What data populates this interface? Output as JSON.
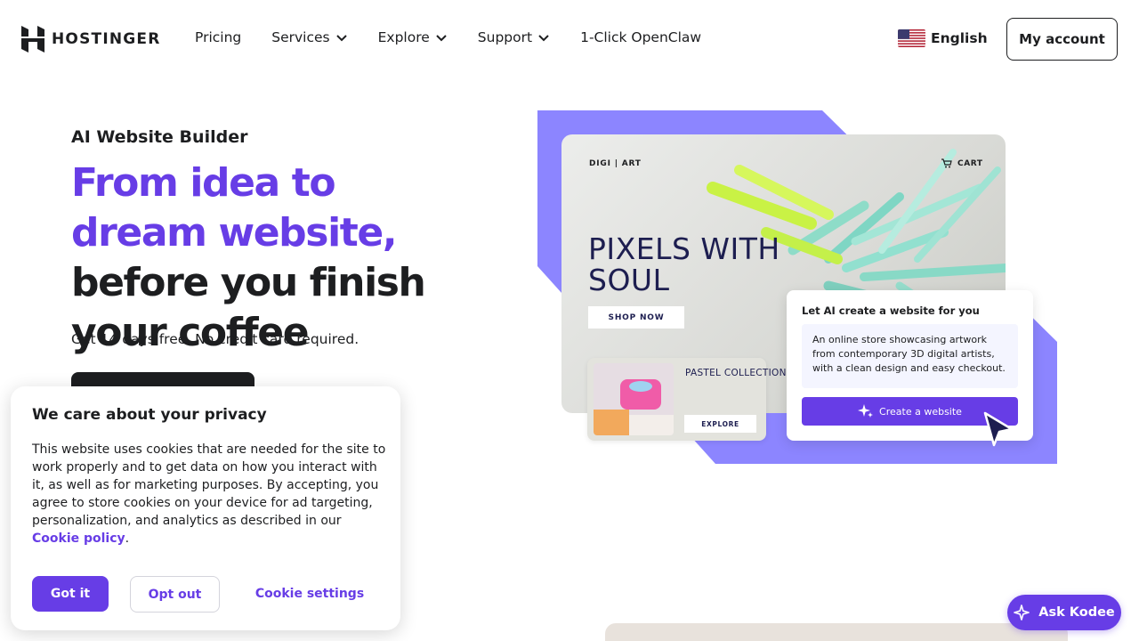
{
  "header": {
    "brand": "HOSTINGER",
    "nav": [
      {
        "label": "Pricing",
        "has_dropdown": false
      },
      {
        "label": "Services",
        "has_dropdown": true
      },
      {
        "label": "Explore",
        "has_dropdown": true
      },
      {
        "label": "Support",
        "has_dropdown": true
      },
      {
        "label": "1-Click OpenClaw",
        "has_dropdown": false
      }
    ],
    "language": "English",
    "language_icon": "us-flag-icon",
    "account_label": "My account"
  },
  "hero": {
    "eyebrow": "AI Website Builder",
    "headline_accent": "From idea to dream website,",
    "headline_rest": " before you finish your coffee",
    "subline": "Get 14 days free. No credit card required."
  },
  "mockup": {
    "brand": "DIGI | ART",
    "cart": "CART",
    "title": "PIXELS WITH SOUL",
    "shop_now": "SHOP NOW",
    "collection": "PASTEL COLLECTION",
    "explore": "EXPLORE",
    "ai_title": "Let AI create a website for you",
    "ai_prompt": "An online store showcasing artwork from contemporary 3D digital artists, with a clean design and easy checkout.",
    "ai_button": "Create a website"
  },
  "cookie": {
    "title": "We care about your privacy",
    "body": "This website uses cookies that are needed for the site to work properly and to get data on how you interact with it, as well as for marketing purposes. By accepting, you agree to store cookies on your device for ad targeting, personalization, and analytics as described in our ",
    "link": "Cookie policy",
    "got_it": "Got it",
    "opt_out": "Opt out",
    "settings": "Cookie settings"
  },
  "assistant": {
    "label": "Ask Kodee"
  },
  "colors": {
    "accent": "#673de6",
    "accent_light": "#8c85ff",
    "text": "#1d1e20"
  }
}
